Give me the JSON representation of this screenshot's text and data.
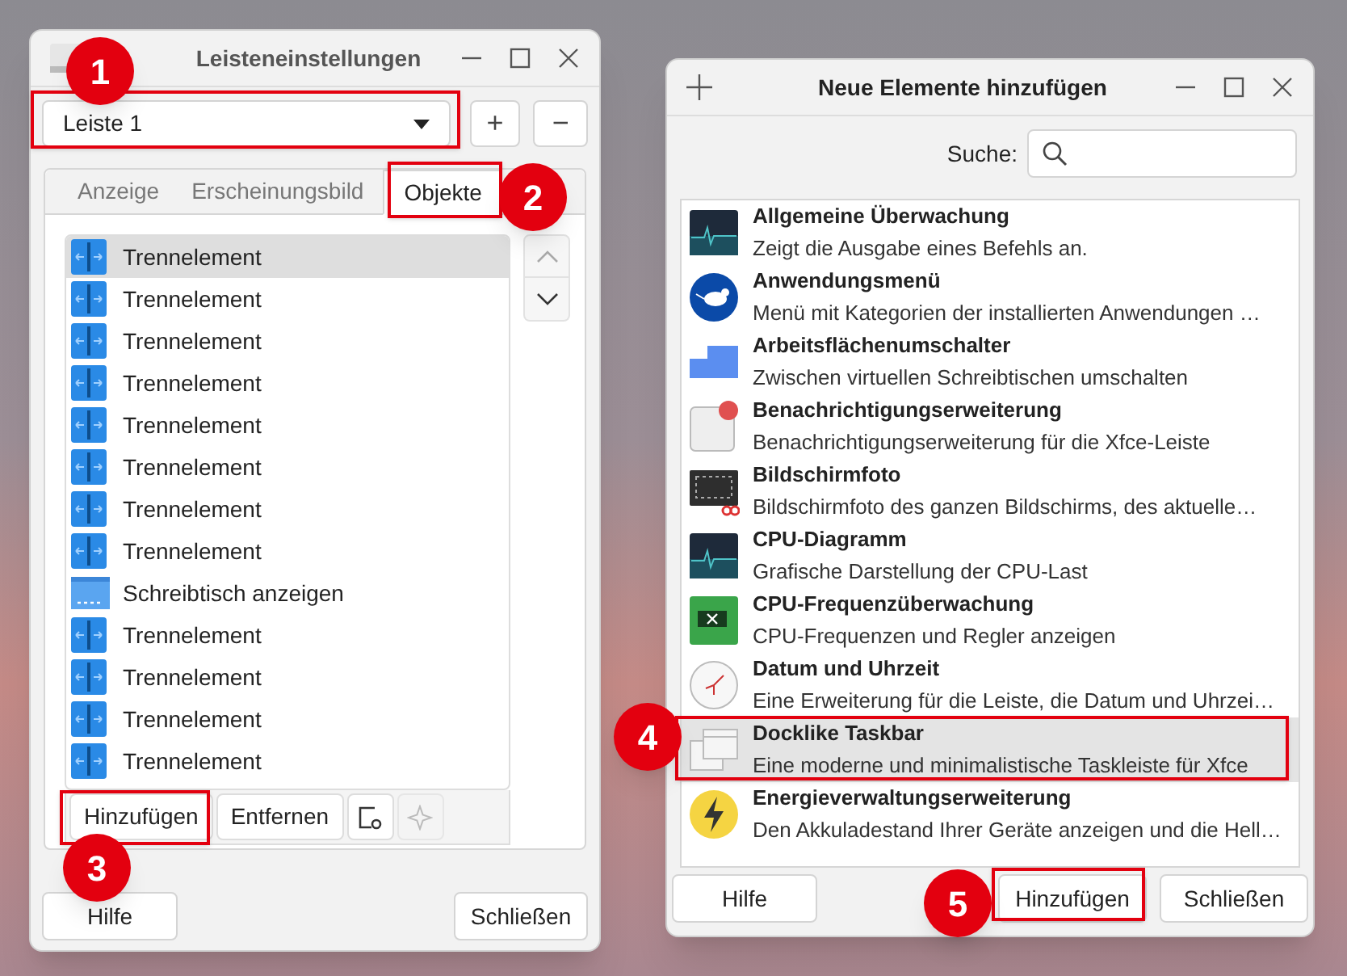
{
  "panel_window": {
    "title": "Leisteneinstellungen",
    "panel_select": {
      "value": "Leiste 1"
    },
    "add_panel_button": "+",
    "remove_panel_button": "−",
    "tabs": [
      {
        "label": "Anzeige",
        "selected": false
      },
      {
        "label": "Erscheinungsbild",
        "selected": false
      },
      {
        "label": "Objekte",
        "selected": true
      }
    ],
    "items": [
      {
        "kind": "separator",
        "label": "Trennelement",
        "selected": true
      },
      {
        "kind": "separator",
        "label": "Trennelement",
        "selected": false
      },
      {
        "kind": "separator",
        "label": "Trennelement",
        "selected": false
      },
      {
        "kind": "separator",
        "label": "Trennelement",
        "selected": false
      },
      {
        "kind": "separator",
        "label": "Trennelement",
        "selected": false
      },
      {
        "kind": "separator",
        "label": "Trennelement",
        "selected": false
      },
      {
        "kind": "separator",
        "label": "Trennelement",
        "selected": false
      },
      {
        "kind": "separator",
        "label": "Trennelement",
        "selected": false
      },
      {
        "kind": "desktop",
        "label": "Schreibtisch anzeigen",
        "selected": false
      },
      {
        "kind": "separator",
        "label": "Trennelement",
        "selected": false
      },
      {
        "kind": "separator",
        "label": "Trennelement",
        "selected": false
      },
      {
        "kind": "separator",
        "label": "Trennelement",
        "selected": false
      },
      {
        "kind": "separator",
        "label": "Trennelement",
        "selected": false
      }
    ],
    "toolbar": {
      "add": "Hinzufügen",
      "remove": "Entfernen",
      "about_disabled": true
    },
    "buttons": {
      "help": "Hilfe",
      "close": "Schließen"
    }
  },
  "add_window": {
    "title": "Neue Elemente hinzufügen",
    "search_label": "Suche:",
    "items": [
      {
        "kind": "monitor",
        "name": "Allgemeine Überwachung",
        "description": "Zeigt die Ausgabe eines Befehls an.",
        "selected": false
      },
      {
        "kind": "menu",
        "name": "Anwendungsmenü",
        "description": "Menü mit Kategorien der installierten Anwendungen …",
        "selected": false
      },
      {
        "kind": "workspaces",
        "name": "Arbeitsflächenumschalter",
        "description": "Zwischen virtuellen Schreibtischen umschalten",
        "selected": false
      },
      {
        "kind": "notification",
        "name": "Benachrichtigungserweiterung",
        "description": "Benachrichtigungserweiterung für die Xfce-Leiste",
        "selected": false
      },
      {
        "kind": "screenshot",
        "name": "Bildschirmfoto",
        "description": "Bildschirmfoto des ganzen Bildschirms, des aktuelle…",
        "selected": false
      },
      {
        "kind": "monitor",
        "name": "CPU-Diagramm",
        "description": "Grafische Darstellung der CPU-Last",
        "selected": false
      },
      {
        "kind": "chip",
        "name": "CPU-Frequenzüberwachung",
        "description": "CPU-Frequenzen und Regler anzeigen",
        "selected": false
      },
      {
        "kind": "clock",
        "name": "Datum und Uhrzeit",
        "description": "Eine Erweiterung für die Leiste, die Datum und Uhrzei…",
        "selected": false
      },
      {
        "kind": "taskbar",
        "name": "Docklike Taskbar",
        "description": "Eine moderne und minimalistische Taskleiste für Xfce",
        "selected": true
      },
      {
        "kind": "power",
        "name": "Energieverwaltungserweiterung",
        "description": "Den Akkuladestand Ihrer Geräte anzeigen und die Hell…",
        "selected": false
      }
    ],
    "buttons": {
      "help": "Hilfe",
      "add": "Hinzufügen",
      "close": "Schließen"
    }
  },
  "callouts": [
    {
      "label": "1"
    },
    {
      "label": "2"
    },
    {
      "label": "3"
    },
    {
      "label": "4"
    },
    {
      "label": "5"
    }
  ]
}
